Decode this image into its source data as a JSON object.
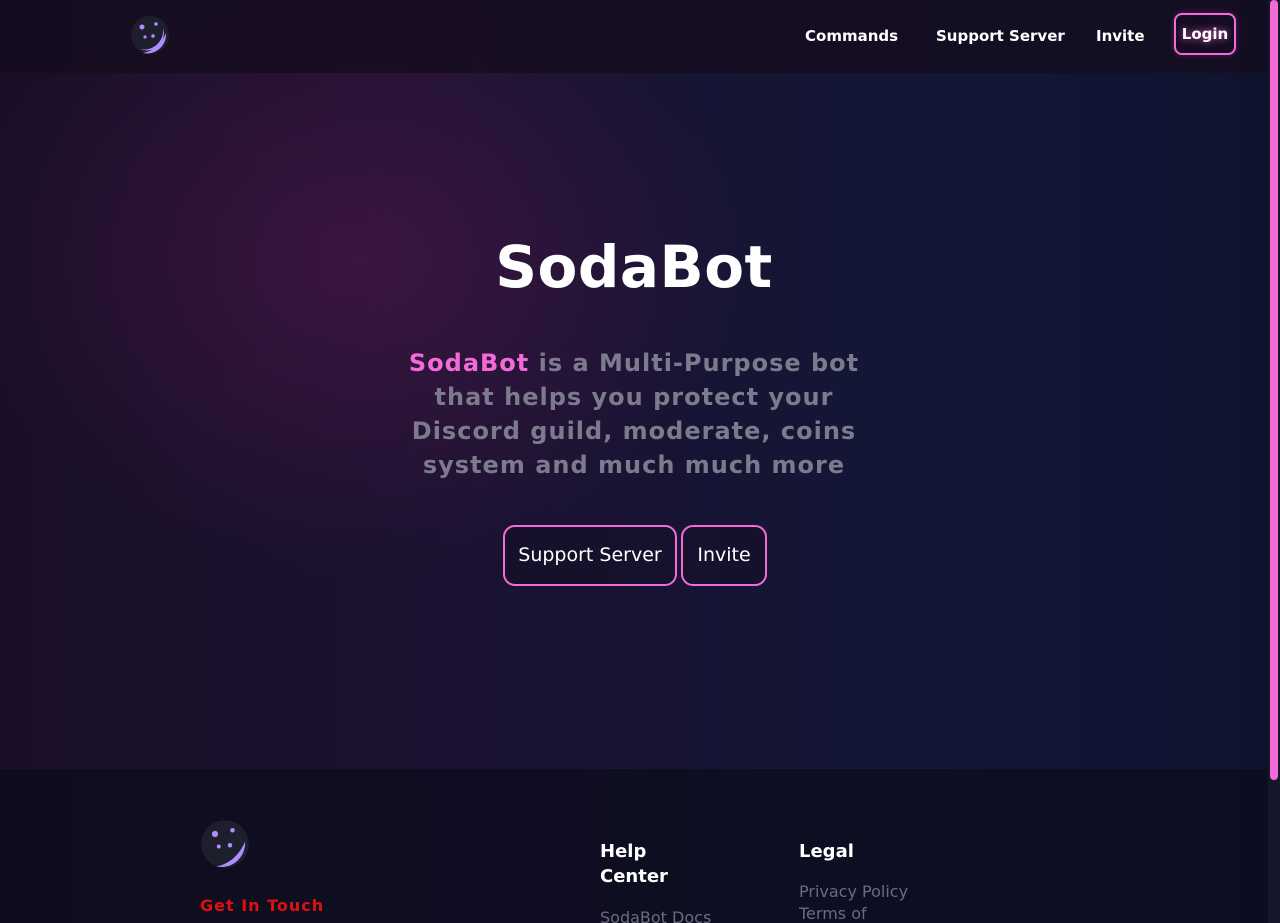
{
  "header": {
    "logo": "sodabot-moon-logo",
    "nav": {
      "commands": "Commands",
      "support_server": "Support Server",
      "invite": "Invite",
      "login": "Login"
    }
  },
  "hero": {
    "title": "SodaBot",
    "description_brand": "SodaBot",
    "description_rest": " is a Multi-Purpose bot that helps you protect your Discord guild, moderate, coins system and much much more",
    "buttons": {
      "support_server": "Support Server",
      "invite": "Invite"
    }
  },
  "footer": {
    "logo": "sodabot-moon-logo",
    "contact_heading": "Get In Touch",
    "help_center": {
      "heading": "Help Center",
      "links": [
        "SodaBot Docs"
      ]
    },
    "legal": {
      "heading": "Legal",
      "links": [
        "Privacy Policy",
        "Terms of"
      ]
    }
  },
  "colors": {
    "accent": "#f46bd8",
    "logo_purple": "#b08cff",
    "contact_red": "#e01010",
    "muted_text": "#7c7a8d"
  }
}
